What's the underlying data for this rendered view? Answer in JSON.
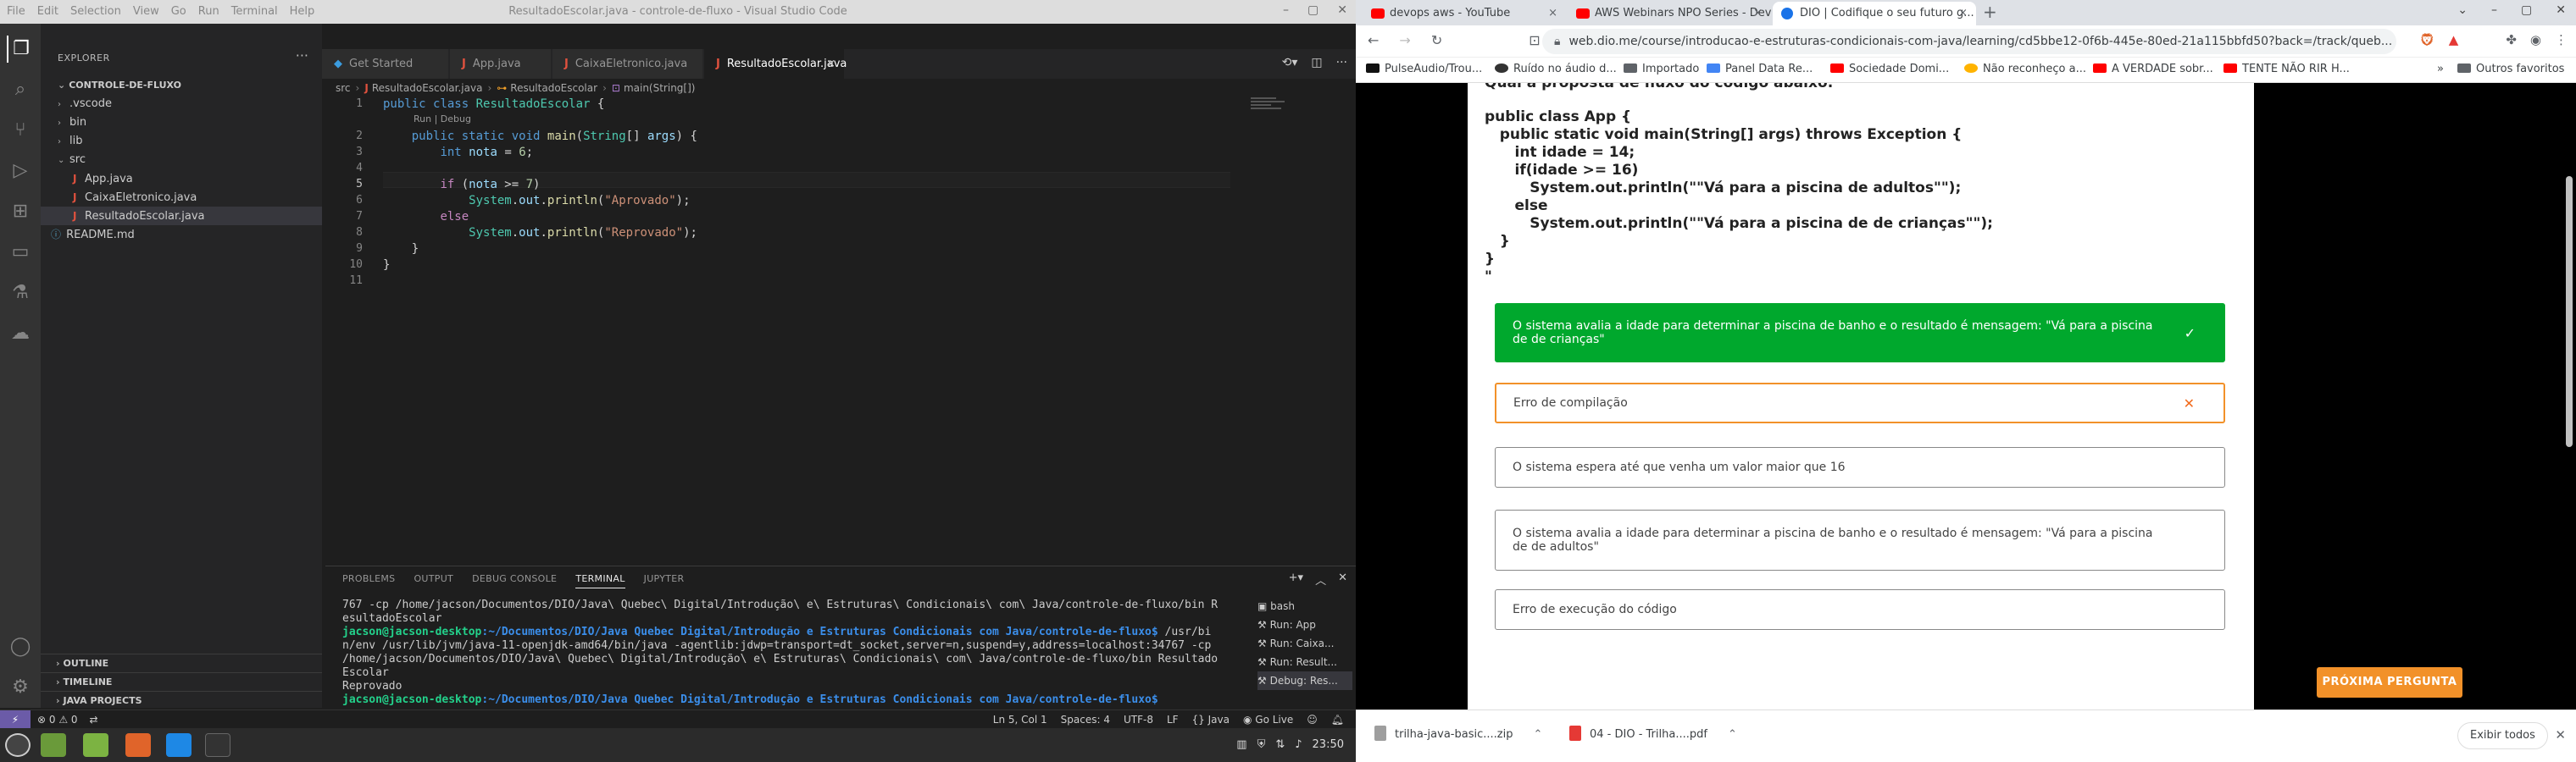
{
  "vscode": {
    "window_title": "ResultadoEscolar.java - controle-de-fluxo - Visual Studio Code",
    "menu": [
      "File",
      "Edit",
      "Selection",
      "View",
      "Go",
      "Run",
      "Terminal",
      "Help"
    ],
    "explorer_title": "EXPLORER",
    "root_folder": "CONTROLE-DE-FLUXO",
    "tree": [
      ".vscode",
      "bin",
      "lib",
      "src",
      "App.java",
      "CaixaEletronico.java",
      "ResultadoEscolar.java",
      "README.md"
    ],
    "outline": "OUTLINE",
    "timeline": "TIMELINE",
    "java_projects": "JAVA PROJECTS",
    "tabs": [
      "Get Started",
      "App.java",
      "CaixaEletronico.java",
      "ResultadoEscolar.java"
    ],
    "breadcrumb": [
      "src",
      "ResultadoEscolar.java",
      "ResultadoEscolar",
      "main(String[])"
    ],
    "codelens": "Run | Debug",
    "line_numbers": [
      "1",
      "2",
      "3",
      "4",
      "5",
      "6",
      "7",
      "8",
      "9",
      "10",
      "11"
    ],
    "panel_tabs": [
      "PROBLEMS",
      "OUTPUT",
      "DEBUG CONSOLE",
      "TERMINAL",
      "JUPYTER"
    ],
    "terminal_lines": [
      "767 -cp /home/jacson/Documentos/DIO/Java\\ Quebec\\ Digital/Introdução\\ e\\ Estruturas\\ Condicionais\\ com\\ Java/controle-de-fluxo/bin R",
      "esultadoEscolar",
      "Escolar",
      "Reprovado"
    ],
    "prompt_user": "jacson@jacson-desktop",
    "prompt_path1": ":~/Documentos/DIO/Java Quebec Digital/Introdução e Estruturas Condicionais com Java/controle-de-fluxo$",
    "prompt_cmd1": "  /usr/bi",
    "terminal_wrap1": "n/env /usr/lib/jvm/java-11-openjdk-amd64/bin/java -agentlib:jdwp=transport=dt_socket,server=n,suspend=y,address=localhost:34767 -cp",
    "terminal_wrap2": " /home/jacson/Documentos/DIO/Java\\ Quebec\\ Digital/Introdução\\ e\\ Estruturas\\ Condicionais\\ com\\ Java/controle-de-fluxo/bin Resultado",
    "prompt_path2": ":~/Documentos/DIO/Java Quebec Digital/Introdução e Estruturas Condicionais com Java/controle-de-fluxo$",
    "terminal_list": [
      "bash",
      "Run: App",
      "Run: Caixa...",
      "Run: Result...",
      "Debug: Res..."
    ],
    "status_left": [
      "⊗ 0 ⚠ 0",
      "⇄"
    ],
    "status_right": [
      "Ln 5, Col 1",
      "Spaces: 4",
      "UTF-8",
      "LF",
      "{} Java",
      "Go Live"
    ]
  },
  "taskbar": {
    "clock": "23:50"
  },
  "chrome": {
    "tabs": [
      "devops aws - YouTube",
      "AWS Webinars NPO Series - Devo...",
      "DIO | Codifique o seu futuro g..."
    ],
    "url": "web.dio.me/course/introducao-e-estruturas-condicionais-com-java/learning/cd5bbe12-0f6b-445e-80ed-21a115bbfd50?back=/track/queb...",
    "bookmarks": [
      "PulseAudio/Trou...",
      "Ruído no áudio d...",
      "Importado",
      "Panel Data Re...",
      "Sociedade Domi...",
      "Não reconheço a...",
      "A VERDADE sobr...",
      "TENTE NÃO RIR H..."
    ],
    "other_bookmarks": "Outros favoritos",
    "question_head": "Qual a proposta de fluxo do código abaixo:",
    "question_code": "public class App {\n   public static void main(String[] args) throws Exception {\n      int idade = 14;\n      if(idade >= 16)\n         System.out.println(\"\"Vá para a piscina de adultos\"\");\n      else\n         System.out.println(\"\"Vá para a piscina de de crianças\"\");\n   }\n}\n\"",
    "options": [
      {
        "text": "O sistema avalia a idade para determinar a piscina de banho e o resultado é mensagem: \"Vá para a piscina de de crianças\"",
        "state": "correct"
      },
      {
        "text": "Erro de compilação",
        "state": "wrong"
      },
      {
        "text": "O sistema espera até que venha um valor maior que 16",
        "state": "plain"
      },
      {
        "text": "O sistema avalia a idade para determinar a piscina de banho e o resultado é mensagem: \"Vá para a piscina de de adultos\"",
        "state": "plain"
      },
      {
        "text": "Erro de execução do código",
        "state": "plain"
      }
    ],
    "next_button": "PRÓXIMA PERGUNTA",
    "downloads": [
      "trilha-java-basic....zip",
      "04 - DIO - Trilha....pdf"
    ],
    "show_all": "Exibir todos"
  }
}
